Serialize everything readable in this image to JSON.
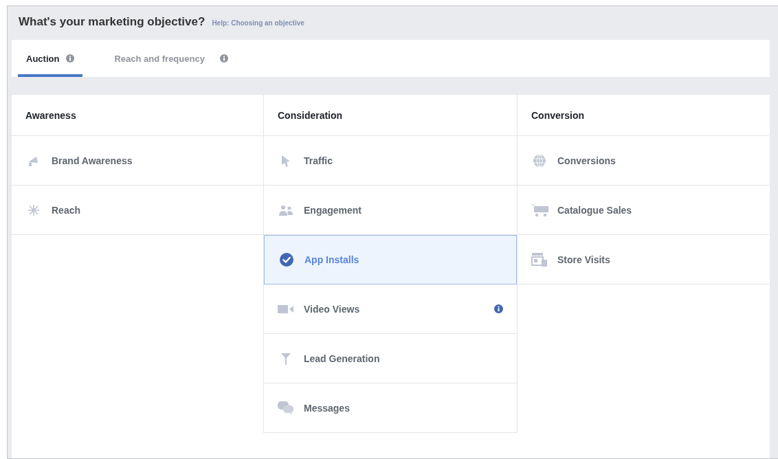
{
  "header": {
    "title": "What's your marketing objective?",
    "help_link": "Help: Choosing an objective"
  },
  "tabs": [
    {
      "label": "Auction",
      "selected": true
    },
    {
      "label": "Reach and frequency",
      "selected": false
    }
  ],
  "columns": [
    {
      "heading": "Awareness",
      "items": [
        {
          "label": "Brand Awareness",
          "selected": false,
          "info": false
        },
        {
          "label": "Reach",
          "selected": false,
          "info": false
        }
      ]
    },
    {
      "heading": "Consideration",
      "items": [
        {
          "label": "Traffic",
          "selected": false,
          "info": false
        },
        {
          "label": "Engagement",
          "selected": false,
          "info": false
        },
        {
          "label": "App Installs",
          "selected": true,
          "info": false
        },
        {
          "label": "Video Views",
          "selected": false,
          "info": true
        },
        {
          "label": "Lead Generation",
          "selected": false,
          "info": false
        },
        {
          "label": "Messages",
          "selected": false,
          "info": false
        }
      ]
    },
    {
      "heading": "Conversion",
      "items": [
        {
          "label": "Conversions",
          "selected": false,
          "info": false
        },
        {
          "label": "Catalogue Sales",
          "selected": false,
          "info": false
        },
        {
          "label": "Store Visits",
          "selected": false,
          "info": false
        }
      ]
    }
  ]
}
